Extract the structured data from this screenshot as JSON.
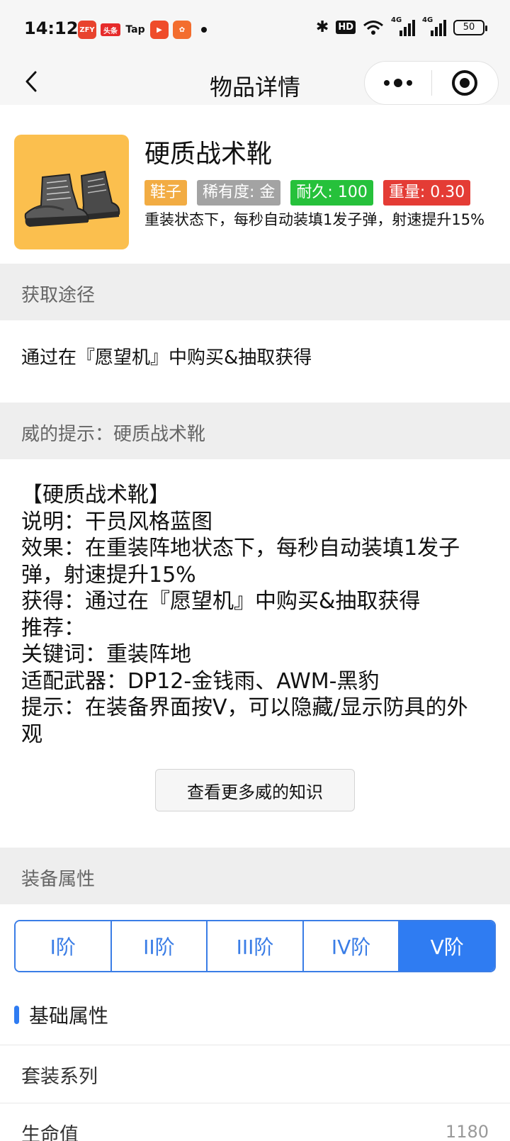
{
  "status_bar": {
    "time": "14:12",
    "apps": [
      "ZFY",
      "头条",
      "Tap",
      "▶",
      "✿"
    ],
    "hd": "HD",
    "signal1": "4G",
    "signal2": "4G",
    "battery": "50"
  },
  "nav": {
    "title": "物品详情"
  },
  "item": {
    "name": "硬质战术靴",
    "tags": [
      "鞋子",
      "稀有度: 金",
      "耐久: 100",
      "重量: 0.30"
    ],
    "description": "重装状态下，每秒自动装填1发子弹，射速提升15%"
  },
  "obtain": {
    "header": "获取途径",
    "text": "通过在『愿望机』中购买&抽取获得"
  },
  "tips": {
    "header": "威的提示：硬质战术靴",
    "lines": [
      "【硬质战术靴】",
      "说明：干员风格蓝图",
      "效果：在重装阵地状态下，每秒自动装填1发子弹，射速提升15%",
      "获得：通过在『愿望机』中购买&抽取获得",
      "推荐：",
      "关键词：重装阵地",
      "适配武器：DP12-金钱雨、AWM-黑豹",
      "提示：在装备界面按V，可以隐藏/显示防具的外观"
    ],
    "more_button": "查看更多威的知识"
  },
  "attributes": {
    "header": "装备属性",
    "tiers": [
      "I阶",
      "II阶",
      "III阶",
      "IV阶",
      "V阶"
    ],
    "active_tier": 4,
    "basic_title": "基础属性",
    "rows": [
      {
        "label": "套装系列",
        "value": ""
      },
      {
        "label": "生命值",
        "value": "1180"
      }
    ]
  },
  "colors": {
    "accent": "#2f7cf2",
    "tag_type": "#f2ac43",
    "tag_rarity": "#a3a3a3",
    "tag_durability": "#26c13b",
    "tag_weight": "#e43c35",
    "item_bg": "#fbbf4e"
  }
}
